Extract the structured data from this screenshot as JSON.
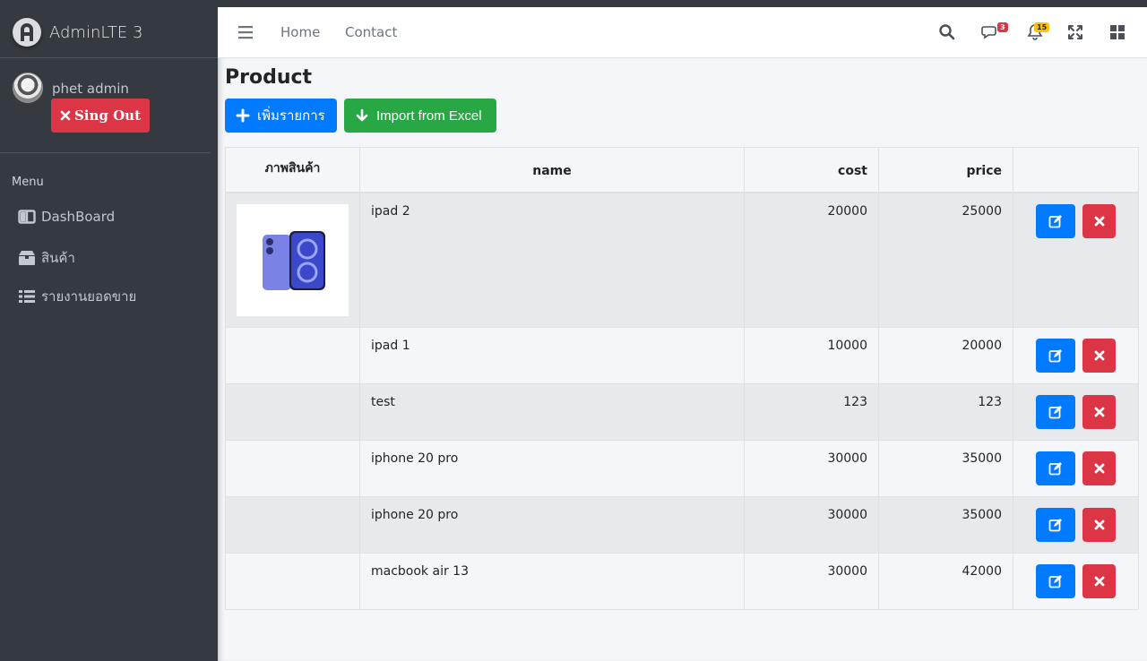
{
  "brand": {
    "title": "AdminLTE 3"
  },
  "user": {
    "name": "phet admin",
    "signout_label": "Sing Out"
  },
  "sidebar": {
    "menu_header": "Menu",
    "items": [
      {
        "label": "DashBoard",
        "icon": "columns-icon"
      },
      {
        "label": "สินค้า",
        "icon": "box-icon"
      },
      {
        "label": "รายงานยอดขาย",
        "icon": "list-icon"
      }
    ]
  },
  "navbar": {
    "links": [
      "Home",
      "Contact"
    ],
    "messages_badge": "3",
    "notifications_badge": "15"
  },
  "page": {
    "title": "Product",
    "add_button": "เพิ่มรายการ",
    "import_button": "Import from Excel"
  },
  "table": {
    "headers": [
      "ภาพสินค้า",
      "name",
      "cost",
      "price",
      ""
    ],
    "rows": [
      {
        "name": "ipad 2",
        "cost": "20000",
        "price": "25000",
        "has_image": true
      },
      {
        "name": "ipad 1",
        "cost": "10000",
        "price": "20000",
        "has_image": false
      },
      {
        "name": "test",
        "cost": "123",
        "price": "123",
        "has_image": false
      },
      {
        "name": "iphone 20 pro",
        "cost": "30000",
        "price": "35000",
        "has_image": false
      },
      {
        "name": "iphone 20 pro",
        "cost": "30000",
        "price": "35000",
        "has_image": false
      },
      {
        "name": "macbook air 13",
        "cost": "30000",
        "price": "42000",
        "has_image": false
      }
    ]
  },
  "colors": {
    "primary": "#007bff",
    "success": "#28a745",
    "danger": "#dc3545",
    "sidebar": "#343a40"
  }
}
